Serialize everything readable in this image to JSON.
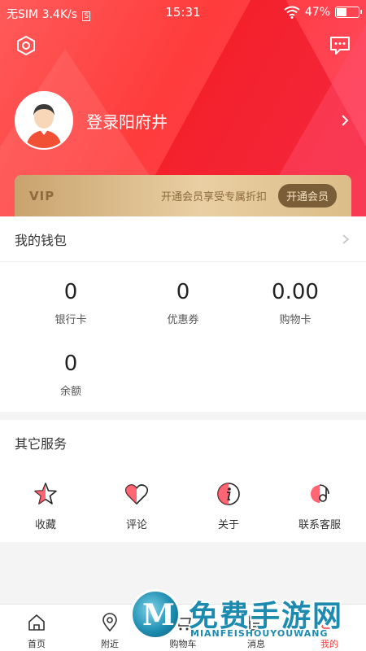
{
  "status_bar": {
    "carrier": "无SIM",
    "speed": "3.4K/s",
    "sim_box": "S",
    "time": "15:31",
    "battery": "47%",
    "battery_level": 0.47
  },
  "header": {
    "login_text": "登录阳府井"
  },
  "vip": {
    "label": "VIP",
    "promo": "开通会员享受专属折扣",
    "button": "开通会员"
  },
  "wallet": {
    "title": "我的钱包",
    "stats": [
      {
        "value": "0",
        "label": "银行卡"
      },
      {
        "value": "0",
        "label": "优惠券"
      },
      {
        "value": "0.00",
        "label": "购物卡"
      },
      {
        "value": "0",
        "label": "余额"
      }
    ]
  },
  "services": {
    "title": "其它服务",
    "items": [
      {
        "label": "收藏",
        "icon": "star-icon"
      },
      {
        "label": "评论",
        "icon": "heart-icon"
      },
      {
        "label": "关于",
        "icon": "info-icon"
      },
      {
        "label": "联系客服",
        "icon": "customer-service-icon"
      }
    ]
  },
  "tabbar": {
    "items": [
      {
        "label": "首页",
        "icon": "home-icon"
      },
      {
        "label": "附近",
        "icon": "location-icon"
      },
      {
        "label": "购物车",
        "icon": "cart-icon"
      },
      {
        "label": "消息",
        "icon": "message-icon"
      },
      {
        "label": "我的",
        "icon": "profile-icon"
      }
    ]
  },
  "watermark": {
    "title": "免费手游网",
    "subtitle": "MIANFEISHOUYOUWANG",
    "logo_letter": "M"
  },
  "colors": {
    "accent": "#ff3b3b",
    "vip_gold": "#c9a36e",
    "watermark_blue": "#1d8ab0"
  }
}
